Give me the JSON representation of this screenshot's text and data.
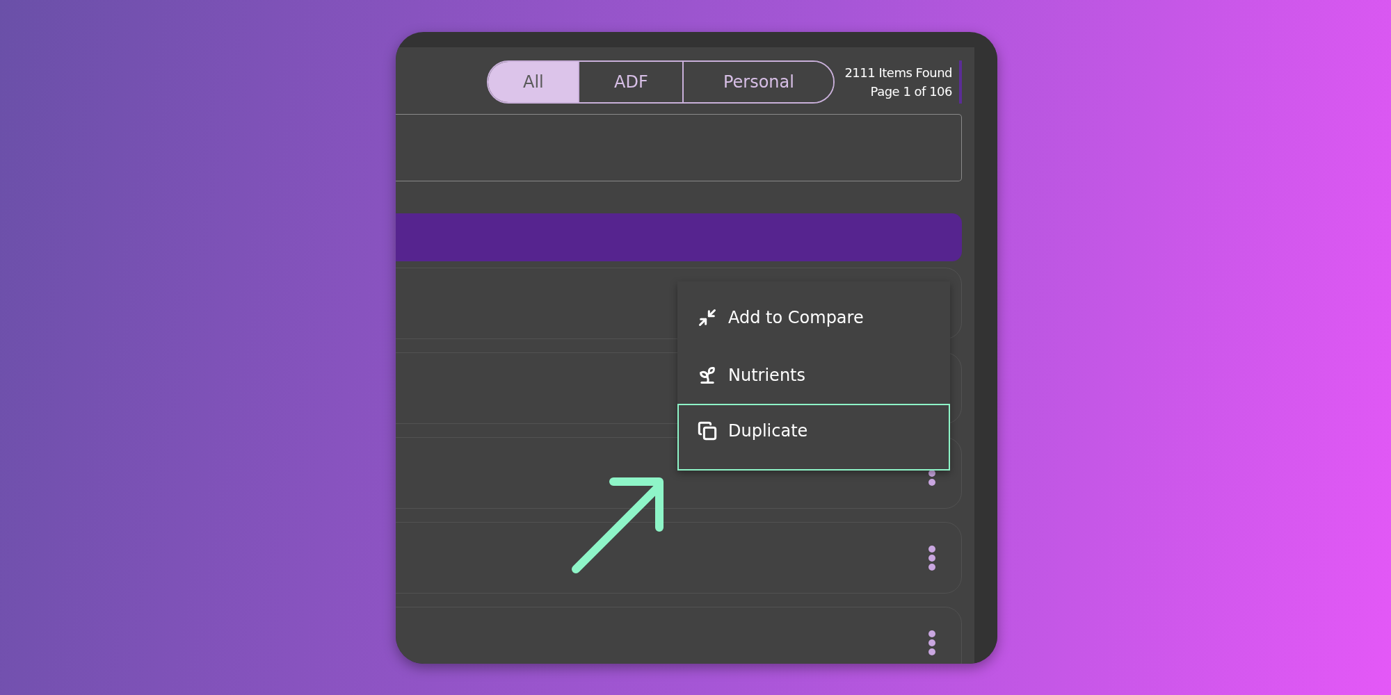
{
  "tabs": [
    {
      "label": "All",
      "selected": true
    },
    {
      "label": "ADF",
      "selected": false
    },
    {
      "label": "Personal",
      "selected": false
    }
  ],
  "results": {
    "count": "2111 Items Found",
    "page": "Page 1 of 106"
  },
  "context_menu": {
    "items": [
      {
        "kind": "compare",
        "label": "Add to Compare",
        "selected": false
      },
      {
        "kind": "nutrients",
        "label": "Nutrients",
        "selected": false
      },
      {
        "kind": "duplicate",
        "label": "Duplicate",
        "selected": true
      }
    ]
  }
}
